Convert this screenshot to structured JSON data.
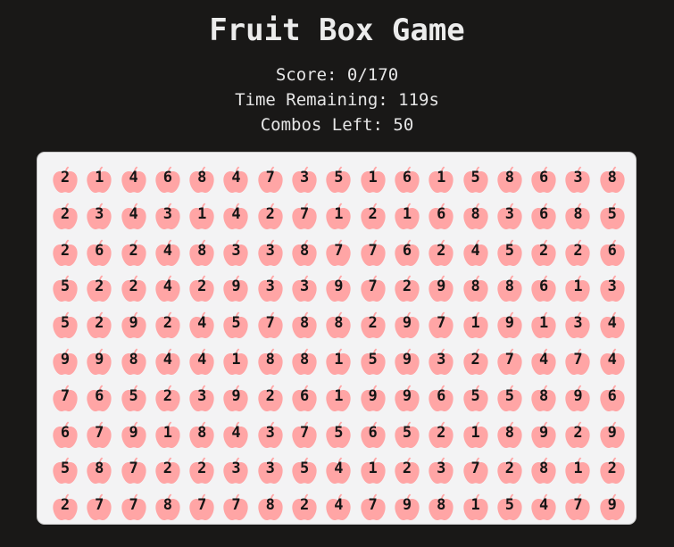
{
  "title": "Fruit Box Game",
  "stats": {
    "score": "Score: 0/170",
    "time": "Time Remaining: 119s",
    "combos": "Combos Left: 50"
  },
  "colors": {
    "background": "#191817",
    "board": "#f3f3f4",
    "apple": "#ffa5a5",
    "number": "#151515"
  },
  "apple_icon": "apple-icon",
  "grid": [
    [
      2,
      1,
      4,
      6,
      8,
      4,
      7,
      3,
      5,
      1,
      6,
      1,
      5,
      8,
      6,
      3,
      8
    ],
    [
      2,
      3,
      4,
      3,
      1,
      4,
      2,
      7,
      1,
      2,
      1,
      6,
      8,
      3,
      6,
      8,
      5
    ],
    [
      2,
      6,
      2,
      4,
      8,
      3,
      3,
      8,
      7,
      7,
      6,
      2,
      4,
      5,
      2,
      2,
      6
    ],
    [
      5,
      2,
      2,
      4,
      2,
      9,
      3,
      3,
      9,
      7,
      2,
      9,
      8,
      8,
      6,
      1,
      3
    ],
    [
      5,
      2,
      9,
      2,
      4,
      5,
      7,
      8,
      8,
      2,
      9,
      7,
      1,
      9,
      1,
      3,
      4
    ],
    [
      9,
      9,
      8,
      4,
      4,
      1,
      8,
      8,
      1,
      5,
      9,
      3,
      2,
      7,
      4,
      7,
      4
    ],
    [
      7,
      6,
      5,
      2,
      3,
      9,
      2,
      6,
      1,
      9,
      9,
      6,
      5,
      5,
      8,
      9,
      6
    ],
    [
      6,
      7,
      9,
      1,
      8,
      4,
      3,
      7,
      5,
      6,
      5,
      2,
      1,
      8,
      9,
      2,
      9
    ],
    [
      5,
      8,
      7,
      2,
      2,
      3,
      3,
      5,
      4,
      1,
      2,
      3,
      7,
      2,
      8,
      1,
      2
    ],
    [
      2,
      7,
      7,
      8,
      7,
      7,
      8,
      2,
      4,
      7,
      9,
      8,
      1,
      5,
      4,
      7,
      9
    ]
  ]
}
